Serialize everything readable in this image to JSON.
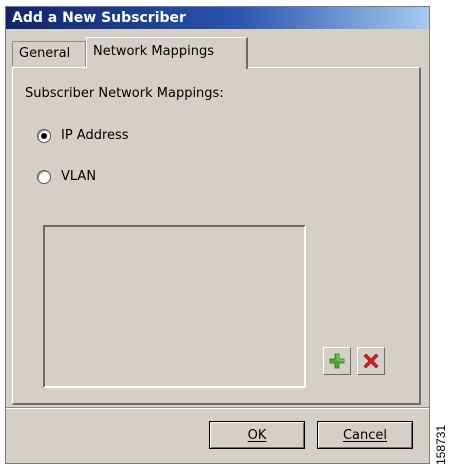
{
  "window": {
    "title": "Add a New Subscriber"
  },
  "tabs": [
    {
      "label": "General",
      "active": false
    },
    {
      "label": "Network Mappings",
      "active": true
    }
  ],
  "panel": {
    "label": "Subscriber Network Mappings:",
    "radios": [
      {
        "label": "IP Address",
        "checked": true
      },
      {
        "label": "VLAN",
        "checked": false
      }
    ],
    "mappings": []
  },
  "icons": {
    "add": "plus-icon",
    "remove": "delete-x-icon"
  },
  "colors": {
    "add": "#4caf2a",
    "remove": "#d42020",
    "title_start": "#10246a",
    "title_end": "#a6caf0",
    "dialog_bg": "#d4d0c8"
  },
  "buttons": {
    "ok": "OK",
    "cancel": "Cancel"
  },
  "figure_id": "158731"
}
